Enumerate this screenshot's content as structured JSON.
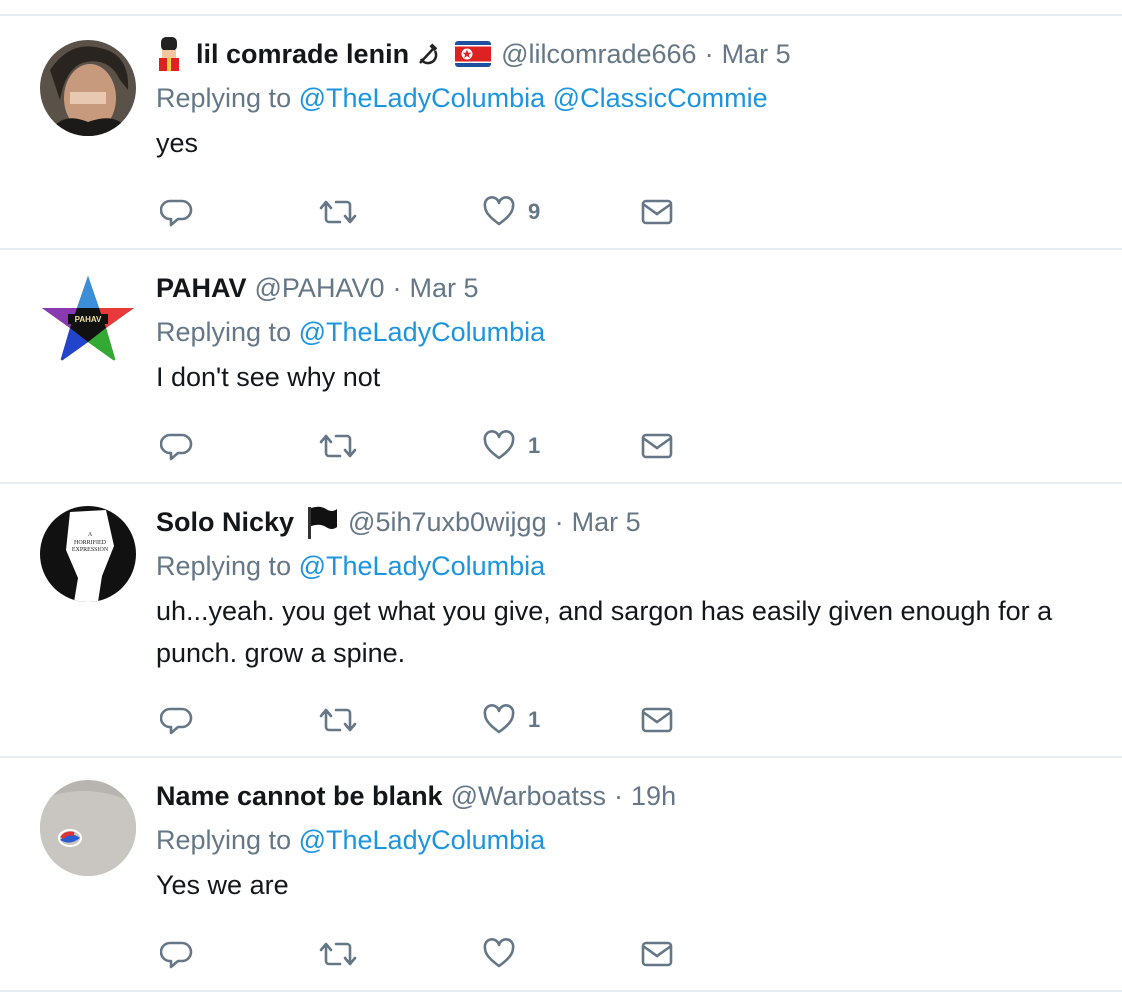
{
  "colors": {
    "link": "#1b95e0",
    "muted": "#657786",
    "divider": "#e6ecf0"
  },
  "tweets": [
    {
      "name": "lil comrade lenin",
      "handle": "@lilcomrade666",
      "sep": "·",
      "time": "Mar 5",
      "replying_prefix": "Replying to",
      "mentions": [
        "@TheLadyColumbia",
        "@ClassicCommie"
      ],
      "text": "yes",
      "likes": "9",
      "icons": [
        "guard-emoji-icon",
        "hammer-sickle-icon",
        "north-korea-flag-icon"
      ]
    },
    {
      "name": "PAHAV",
      "handle": "@PAHAV0",
      "sep": "·",
      "time": "Mar 5",
      "replying_prefix": "Replying to",
      "mentions": [
        "@TheLadyColumbia"
      ],
      "text": "I don't see why not",
      "likes": "1",
      "avatar_label": "PAHAV"
    },
    {
      "name": "Solo Nicky",
      "handle": "@5ih7uxb0wijgg",
      "sep": "·",
      "time": "Mar 5",
      "replying_prefix": "Replying to",
      "mentions": [
        "@TheLadyColumbia"
      ],
      "text_line1": "uh...yeah. you get what you give, and sargon has easily given enough for a",
      "text_line2": "punch. grow a spine.",
      "likes": "1",
      "icons": [
        "black-flag-icon"
      ]
    },
    {
      "name": "Name cannot be blank",
      "handle": "@Warboatss",
      "sep": "·",
      "time": "19h",
      "replying_prefix": "Replying to",
      "mentions": [
        "@TheLadyColumbia"
      ],
      "text": "Yes we are",
      "likes": ""
    }
  ]
}
